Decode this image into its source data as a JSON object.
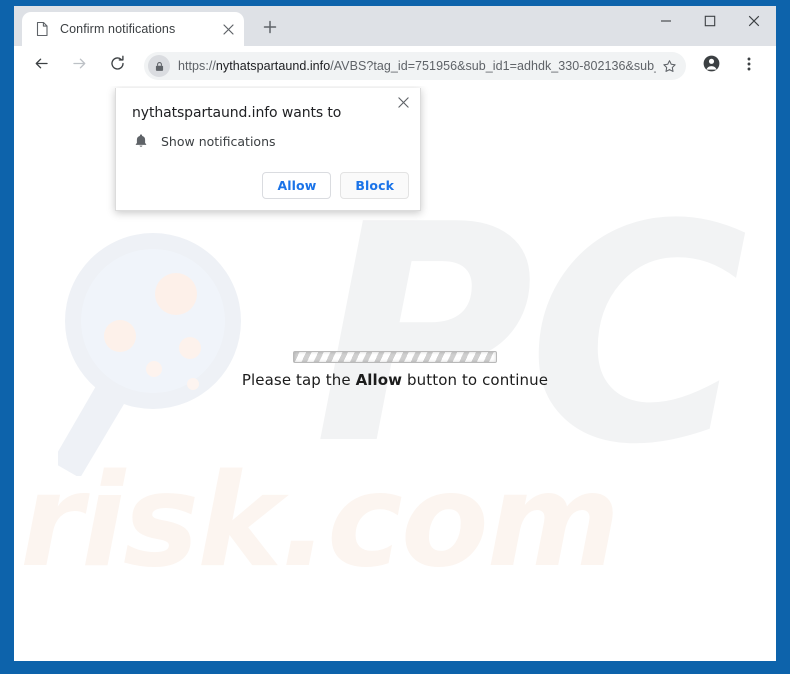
{
  "window": {
    "border_color": "#0d63ab",
    "controls": {
      "minimize": "minimize-icon",
      "maximize": "maximize-icon",
      "close": "close-icon"
    }
  },
  "tabstrip": {
    "tab": {
      "title": "Confirm notifications",
      "favicon": "page-icon",
      "close": "close-icon"
    },
    "new_tab": "plus-icon"
  },
  "toolbar": {
    "back": "back-arrow-icon",
    "forward": "forward-arrow-icon",
    "reload": "reload-icon",
    "lock": "lock-icon",
    "url_scheme": "https://",
    "url_host": "nythatspartaund.info",
    "url_path": "/AVBS?tag_id=751956&sub_id1=adhdk_330-802136&sub_…",
    "url_full": "https://nythatspartaund.info/AVBS?tag_id=751956&sub_id1=adhdk_330-802136&sub_…",
    "bookmark": "star-icon",
    "profile": "account-avatar-icon",
    "menu": "three-dot-menu-icon"
  },
  "permission_dialog": {
    "title": "nythatspartaund.info wants to",
    "permission_icon": "bell-icon",
    "permission_label": "Show notifications",
    "allow_label": "Allow",
    "block_label": "Block",
    "close": "close-icon",
    "accent_color": "#1a73e8"
  },
  "page": {
    "progress_label": "loading-progress-bar",
    "message_prefix": "Please tap the ",
    "message_emphasis": "Allow",
    "message_suffix": " button to continue",
    "watermark_logo": "PC",
    "watermark_domain": "risk.com",
    "watermark_magnifier": "magnifying-glass-icon"
  }
}
